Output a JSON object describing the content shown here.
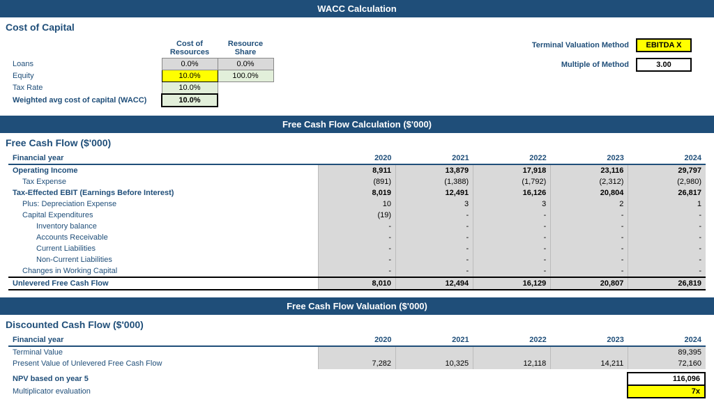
{
  "wacc_header": "WACC Calculation",
  "cost_of_capital_title": "Cost of Capital",
  "wacc_col1": "Cost of Resources",
  "wacc_col2": "Resource Share",
  "loans_label": "Loans",
  "loans_cost": "0.0%",
  "loans_share": "0.0%",
  "equity_label": "Equity",
  "equity_cost": "10.0%",
  "equity_share": "100.0%",
  "tax_rate_label": "Tax Rate",
  "tax_rate_val": "10.0%",
  "wacc_label": "Weighted avg cost of capital (WACC)",
  "wacc_val": "10.0%",
  "terminal_valuation_label": "Terminal Valuation Method",
  "terminal_valuation_val": "EBITDA X",
  "multiple_of_method_label": "Multiple of Method",
  "multiple_of_method_val": "3.00",
  "fcf_header": "Free Cash Flow Calculation ($'000)",
  "fcf_title": "Free Cash Flow ($'000)",
  "dcf_header": "Free Cash Flow Valuation ($'000)",
  "dcf_title": "Discounted Cash Flow ($'000)",
  "years": [
    "2020",
    "2021",
    "2022",
    "2023",
    "2024"
  ],
  "fcf_rows": [
    {
      "label": "Financial year",
      "bold": true,
      "indent": 0,
      "values": [
        "",
        "",
        "",
        "",
        ""
      ],
      "header": true
    },
    {
      "label": "Operating Income",
      "bold": true,
      "indent": 0,
      "values": [
        "8,911",
        "13,879",
        "17,918",
        "23,116",
        "29,797"
      ]
    },
    {
      "label": "Tax Expense",
      "bold": false,
      "indent": 1,
      "values": [
        "(891)",
        "(1,388)",
        "(1,792)",
        "(2,312)",
        "(2,980)"
      ]
    },
    {
      "label": "Tax-Effected EBIT (Earnings Before Interest)",
      "bold": true,
      "indent": 0,
      "values": [
        "8,019",
        "12,491",
        "16,126",
        "20,804",
        "26,817"
      ]
    },
    {
      "label": "Plus: Depreciation Expense",
      "bold": false,
      "indent": 1,
      "values": [
        "10",
        "3",
        "3",
        "2",
        "1"
      ]
    },
    {
      "label": "Capital Expenditures",
      "bold": false,
      "indent": 1,
      "values": [
        "(19)",
        "-",
        "-",
        "-",
        "-"
      ]
    },
    {
      "label": "Inventory balance",
      "bold": false,
      "indent": 2,
      "values": [
        "-",
        "-",
        "-",
        "-",
        "-"
      ]
    },
    {
      "label": "Accounts Receivable",
      "bold": false,
      "indent": 2,
      "values": [
        "-",
        "-",
        "-",
        "-",
        "-"
      ]
    },
    {
      "label": "Current Liabilities",
      "bold": false,
      "indent": 2,
      "values": [
        "-",
        "-",
        "-",
        "-",
        "-"
      ]
    },
    {
      "label": "Non-Current Liabilities",
      "bold": false,
      "indent": 2,
      "values": [
        "-",
        "-",
        "-",
        "-",
        "-"
      ]
    },
    {
      "label": "Changes in Working Capital",
      "bold": false,
      "indent": 1,
      "values": [
        "-",
        "-",
        "-",
        "-",
        "-"
      ]
    },
    {
      "label": "Unlevered Free Cash Flow",
      "bold": true,
      "indent": 0,
      "values": [
        "8,010",
        "12,494",
        "16,129",
        "20,807",
        "26,819"
      ],
      "total": true
    }
  ],
  "dcf_rows": [
    {
      "label": "Financial year",
      "bold": true,
      "indent": 0,
      "values": [
        "",
        "",
        "",
        "",
        ""
      ],
      "header": true
    },
    {
      "label": "Terminal Value",
      "bold": false,
      "indent": 0,
      "values": [
        "",
        "",
        "",
        "",
        "89,395"
      ]
    },
    {
      "label": "Present Value of Unlevered Free Cash Flow",
      "bold": false,
      "indent": 0,
      "values": [
        "7,282",
        "10,325",
        "12,118",
        "14,211",
        "72,160"
      ]
    }
  ],
  "npv_label": "NPV based on year 5",
  "npv_value": "116,096",
  "multiplicator_label": "Multiplicator evaluation",
  "multiplicator_value": "7x"
}
